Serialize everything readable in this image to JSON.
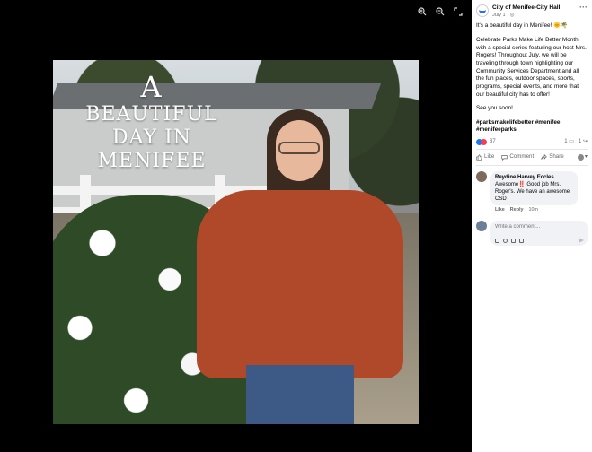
{
  "post": {
    "page_name": "City of Menifee-City Hall",
    "date": "July 1",
    "privacy_sep": "·",
    "paragraphs": [
      "It's a beautiful day in Menifee! 🌞🌴",
      "Celebrate Parks Make Life Better Month with a special series featuring our host Mrs. Rogers! Throughout July, we will be traveling through town highlighting our Community Services Department and all the fun places, outdoor spaces, sports, programs, special events, and more that our beautiful city has to offer!",
      "See you soon!"
    ],
    "hashtags_line1": "#parksmakelifebetter #menifee",
    "hashtags_line2": "#menifeeparks"
  },
  "photo": {
    "headline_l1": "A",
    "headline_l2": "BEAUTIFUL",
    "headline_l3": "DAY IN",
    "headline_l4": "MENIFEE"
  },
  "stats": {
    "reaction_count": "37",
    "comment_count": "1",
    "share_count": "1"
  },
  "actions": {
    "like": "Like",
    "comment": "Comment",
    "share": "Share"
  },
  "comment": {
    "author": "Reydine Harvey Eccles",
    "text": "Awesome‼️ Good job Mrs. Roger's. We have an awesome CSD",
    "like": "Like",
    "reply": "Reply",
    "time": "10m"
  },
  "write_comment": {
    "placeholder": "Write a comment..."
  },
  "colors": {
    "accent": "#1877f2",
    "love": "#f33e58",
    "sweater": "#b0492a"
  }
}
